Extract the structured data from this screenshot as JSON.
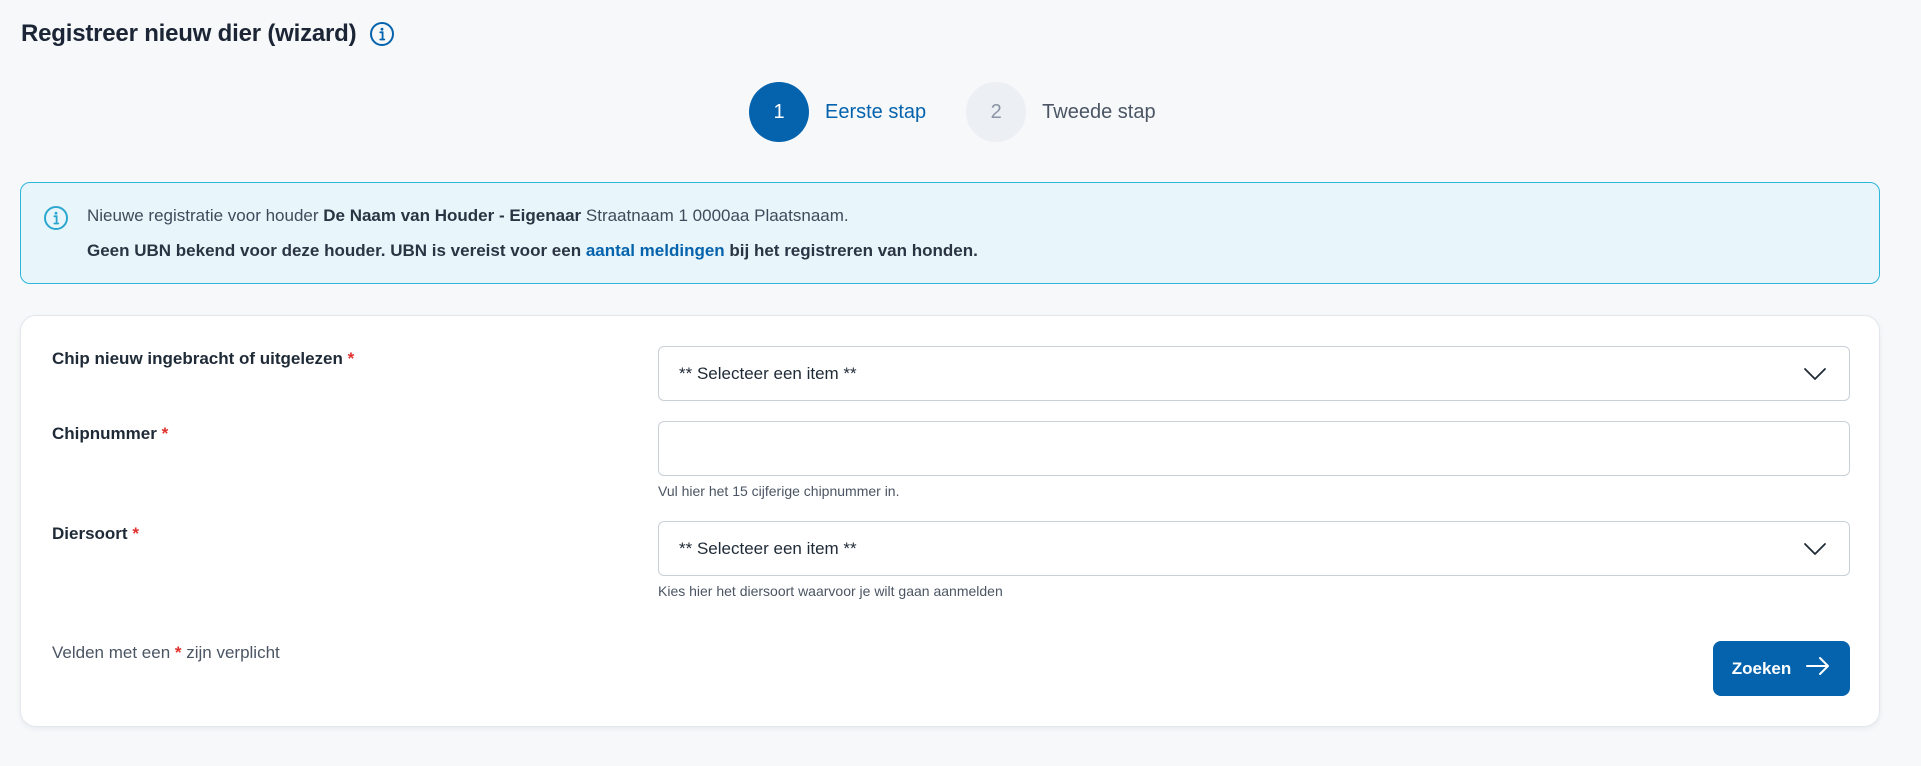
{
  "header": {
    "title": "Registreer nieuw dier (wizard)",
    "info_icon": "info-circle-icon"
  },
  "stepper": {
    "steps": [
      {
        "number": "1",
        "label": "Eerste stap",
        "state": "active"
      },
      {
        "number": "2",
        "label": "Tweede stap",
        "state": "inactive"
      }
    ]
  },
  "alert": {
    "icon": "info-circle-icon",
    "line1": {
      "prefix": "Nieuwe registratie voor houder ",
      "holder": "De Naam van Houder - Eigenaar",
      "address": " Straatnaam 1 0000aa Plaatsnaam."
    },
    "line2": {
      "prefix": "Geen UBN bekend voor deze houder. UBN is vereist voor een ",
      "link": "aantal meldingen",
      "suffix": " bij het registreren van honden."
    }
  },
  "form": {
    "chip_source": {
      "label": "Chip nieuw ingebracht of uitgelezen",
      "required_mark": "*",
      "selected": "** Selecteer een item **"
    },
    "chipnummer": {
      "label": "Chipnummer",
      "required_mark": "*",
      "value": "",
      "hint": "Vul hier het 15 cijferige chipnummer in."
    },
    "diersoort": {
      "label": "Diersoort",
      "required_mark": "*",
      "selected": "** Selecteer een item **",
      "hint": "Kies hier het diersoort waarvoor je wilt gaan aanmelden"
    },
    "footnote": {
      "prefix": "Velden met een ",
      "mark": "*",
      "suffix": " zijn verplicht"
    },
    "submit": {
      "label": "Zoeken",
      "icon": "arrow-right-icon"
    }
  },
  "colors": {
    "primary": "#0563ad",
    "alert_border": "#2eb6d9",
    "alert_background": "#e8f6fb",
    "required": "#e0302c",
    "page_background": "#f6f8fa"
  }
}
